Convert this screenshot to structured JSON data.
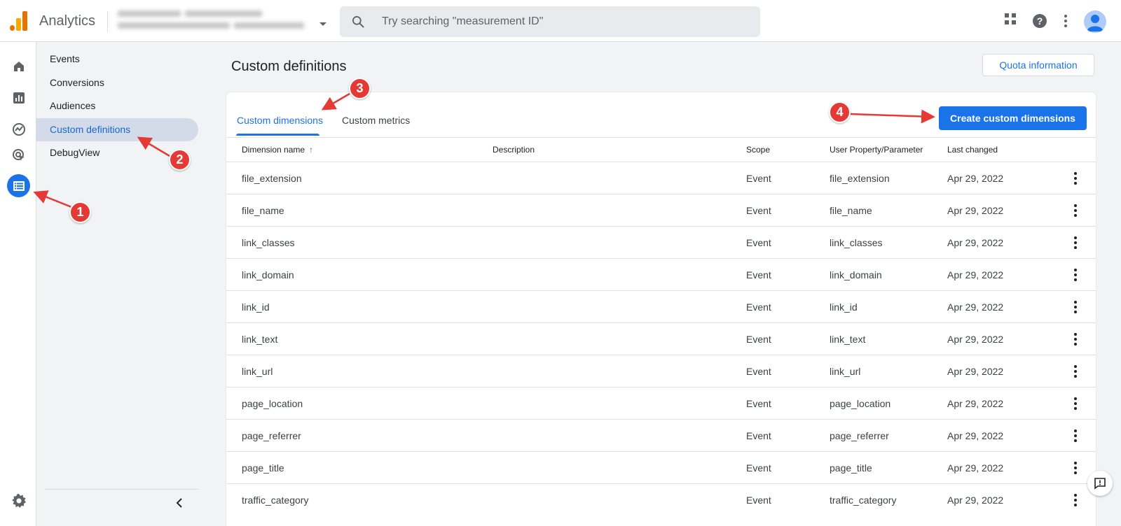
{
  "header": {
    "app_title": "Analytics",
    "search_placeholder": "Try searching \"measurement ID\""
  },
  "rail": {
    "icons": [
      "home-icon",
      "reports-icon",
      "explore-icon",
      "advertising-icon",
      "configure-icon",
      "settings-icon"
    ],
    "active": "configure-icon"
  },
  "subnav": {
    "items": [
      {
        "label": "Events"
      },
      {
        "label": "Conversions"
      },
      {
        "label": "Audiences"
      },
      {
        "label": "Custom definitions",
        "active": true
      },
      {
        "label": "DebugView"
      }
    ]
  },
  "main": {
    "title": "Custom definitions",
    "quota_button": "Quota information",
    "tabs": [
      {
        "label": "Custom dimensions",
        "active": true
      },
      {
        "label": "Custom metrics"
      }
    ],
    "create_button": "Create custom dimensions",
    "columns": {
      "name": "Dimension name",
      "description": "Description",
      "scope": "Scope",
      "parameter": "User Property/Parameter",
      "last_changed": "Last changed"
    },
    "rows": [
      {
        "name": "file_extension",
        "scope": "Event",
        "parameter": "file_extension",
        "last_changed": "Apr 29, 2022"
      },
      {
        "name": "file_name",
        "scope": "Event",
        "parameter": "file_name",
        "last_changed": "Apr 29, 2022"
      },
      {
        "name": "link_classes",
        "scope": "Event",
        "parameter": "link_classes",
        "last_changed": "Apr 29, 2022"
      },
      {
        "name": "link_domain",
        "scope": "Event",
        "parameter": "link_domain",
        "last_changed": "Apr 29, 2022"
      },
      {
        "name": "link_id",
        "scope": "Event",
        "parameter": "link_id",
        "last_changed": "Apr 29, 2022"
      },
      {
        "name": "link_text",
        "scope": "Event",
        "parameter": "link_text",
        "last_changed": "Apr 29, 2022"
      },
      {
        "name": "link_url",
        "scope": "Event",
        "parameter": "link_url",
        "last_changed": "Apr 29, 2022"
      },
      {
        "name": "page_location",
        "scope": "Event",
        "parameter": "page_location",
        "last_changed": "Apr 29, 2022"
      },
      {
        "name": "page_referrer",
        "scope": "Event",
        "parameter": "page_referrer",
        "last_changed": "Apr 29, 2022"
      },
      {
        "name": "page_title",
        "scope": "Event",
        "parameter": "page_title",
        "last_changed": "Apr 29, 2022"
      },
      {
        "name": "traffic_category",
        "scope": "Event",
        "parameter": "traffic_category",
        "last_changed": "Apr 29, 2022"
      }
    ]
  },
  "annotations": {
    "badges": [
      "1",
      "2",
      "3",
      "4"
    ],
    "color": "#e53935"
  },
  "colors": {
    "accent": "#1a73e8",
    "active_nav_bg": "#d3dbe8"
  }
}
